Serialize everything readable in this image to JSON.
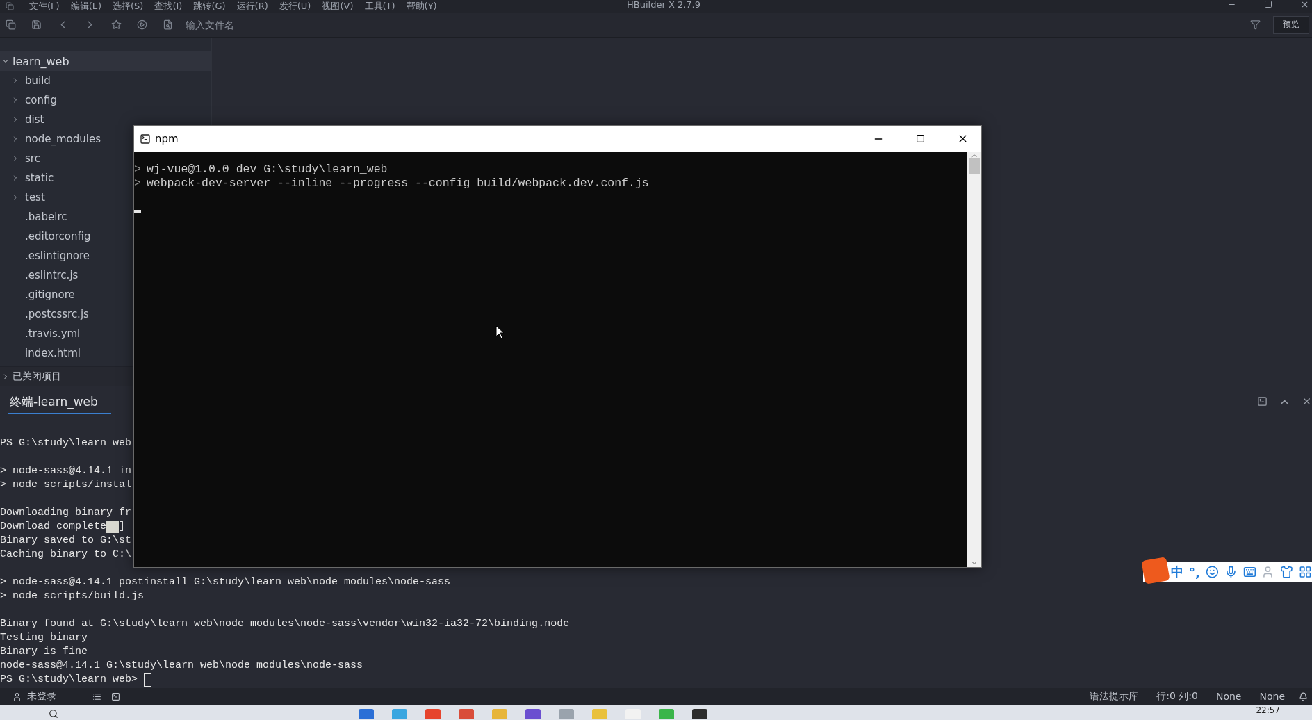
{
  "menu_bar": {
    "items": [
      "文件(F)",
      "编辑(E)",
      "选择(S)",
      "查找(I)",
      "跳转(G)",
      "运行(R)",
      "发行(U)",
      "视图(V)",
      "工具(T)",
      "帮助(Y)"
    ],
    "title": "HBuilder X 2.7.9"
  },
  "toolbar": {
    "file_search": {
      "placeholder": "输入文件名"
    },
    "preview_button": "预览"
  },
  "sidebar": {
    "project": {
      "label": "learn_web",
      "expanded": true,
      "children": [
        {
          "label": "build",
          "kind": "folder"
        },
        {
          "label": "config",
          "kind": "folder"
        },
        {
          "label": "dist",
          "kind": "folder"
        },
        {
          "label": "node_modules",
          "kind": "folder"
        },
        {
          "label": "src",
          "kind": "folder"
        },
        {
          "label": "static",
          "kind": "folder"
        },
        {
          "label": "test",
          "kind": "folder"
        },
        {
          "label": ".babelrc",
          "kind": "file"
        },
        {
          "label": ".editorconfig",
          "kind": "file"
        },
        {
          "label": ".eslintignore",
          "kind": "file"
        },
        {
          "label": ".eslintrc.js",
          "kind": "file"
        },
        {
          "label": ".gitignore",
          "kind": "file"
        },
        {
          "label": ".postcssrc.js",
          "kind": "file"
        },
        {
          "label": ".travis.yml",
          "kind": "file"
        },
        {
          "label": "index.html",
          "kind": "file"
        }
      ]
    },
    "closed_projects": {
      "label": "已关闭项目",
      "expanded": false
    }
  },
  "terminal": {
    "tab": {
      "label": "终端-learn_web",
      "selected": true
    },
    "blocks": [
      [
        {
          "text": "PS G:\\study\\learn web"
        }
      ],
      [
        {
          "text": "> node-sass@4.14.1 in"
        },
        {
          "text": "> node scripts/instal"
        }
      ],
      [
        {
          "text": "Downloading binary fr"
        },
        {
          "text": "Download complete",
          "highlight": true,
          "after": "]"
        },
        {
          "text": "Binary saved to G:\\st"
        },
        {
          "text": "Caching binary to C:\\"
        }
      ],
      [
        {
          "text": "> node-sass@4.14.1 postinstall G:\\study\\learn web\\node modules\\node-sass"
        },
        {
          "text": "> node scripts/build.js"
        }
      ],
      [
        {
          "text": "Binary found at G:\\study\\learn web\\node modules\\node-sass\\vendor\\win32-ia32-72\\binding.node"
        },
        {
          "text": "Testing binary"
        },
        {
          "text": "Binary is fine"
        },
        {
          "text": "node-sass@4.14.1 G:\\study\\learn web\\node modules\\node-sass"
        },
        {
          "text": "PS G:\\study\\learn web>",
          "cursor": true
        }
      ]
    ]
  },
  "status_bar": {
    "user": "未登录",
    "syntax": "语法提示库",
    "position": "行:0 列:0",
    "encoding": "None",
    "language": "None"
  },
  "console_window": {
    "title": "npm",
    "lines": [
      {
        "prompt": ">",
        "text": "wj-vue@1.0.0 dev G:\\study\\learn_web"
      },
      {
        "prompt": ">",
        "text": "webpack-dev-server --inline --progress --config build/webpack.dev.conf.js"
      }
    ],
    "cursor": true
  },
  "ime_bar": {
    "mode": "中",
    "punctuation": "°,"
  },
  "taskbar": {
    "clock": "22:57"
  }
}
